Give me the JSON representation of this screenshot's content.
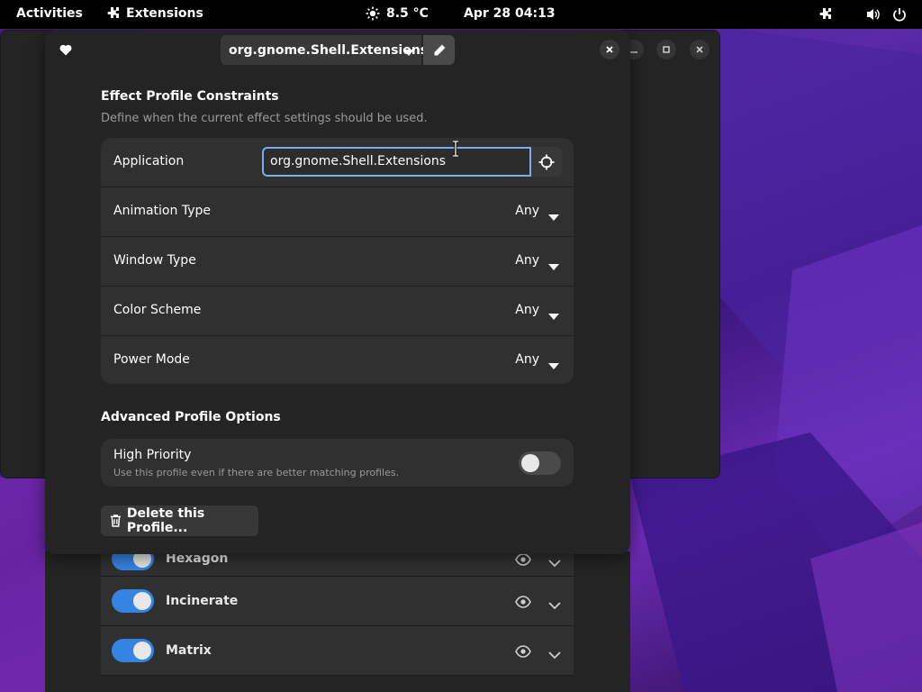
{
  "topbar": {
    "activities": "Activities",
    "app_name": "Extensions",
    "app_icon": "puzzle-icon",
    "weather": "8.5 °C",
    "weather_icon": "sun-icon",
    "clock": "Apr 28  04:13",
    "tray_icons": [
      "puzzle-icon",
      "volume-icon",
      "power-icon"
    ]
  },
  "background_window": {
    "rows": [
      {
        "label": "Hexagon",
        "enabled": true
      },
      {
        "label": "Incinerate",
        "enabled": true
      },
      {
        "label": "Matrix",
        "enabled": true
      }
    ]
  },
  "dialog": {
    "profile": "org.gnome.Shell.Extensions",
    "constraints": {
      "title": "Effect Profile Constraints",
      "description": "Define when the current effect settings should be used.",
      "application_label": "Application",
      "application_value": "org.gnome.Shell.Extensions",
      "rows": [
        {
          "label": "Animation Type",
          "value": "Any"
        },
        {
          "label": "Window Type",
          "value": "Any"
        },
        {
          "label": "Color Scheme",
          "value": "Any"
        },
        {
          "label": "Power Mode",
          "value": "Any"
        }
      ]
    },
    "advanced": {
      "title": "Advanced Profile Options",
      "high_priority_label": "High Priority",
      "high_priority_sub": "Use this profile even if there are better matching profiles.",
      "high_priority_on": false
    },
    "delete_label": "Delete this Profile..."
  },
  "colors": {
    "accent": "#3584e4",
    "focus_ring": "#78aeed",
    "window_bg": "#242424",
    "card_bg": "#303030"
  }
}
